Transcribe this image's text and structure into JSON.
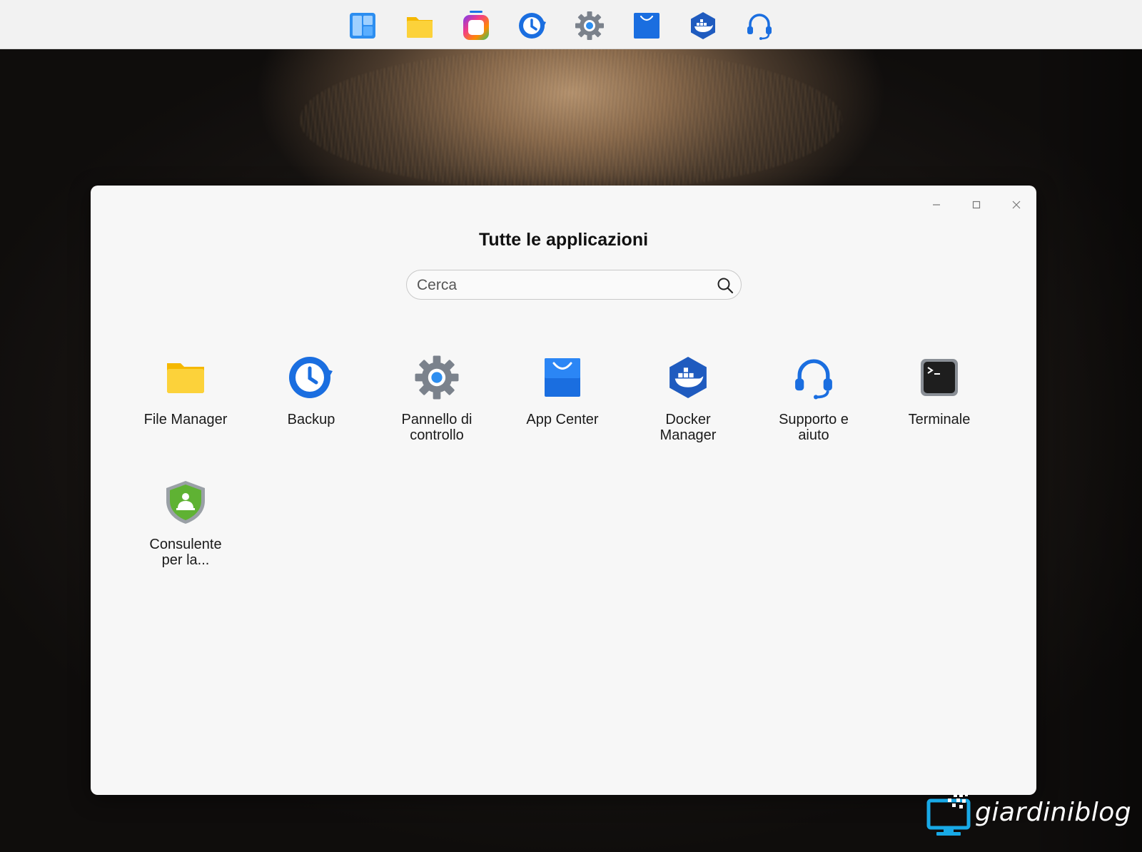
{
  "dock": {
    "items": [
      {
        "icon": "dashboard-icon"
      },
      {
        "icon": "file-manager-icon"
      },
      {
        "icon": "all-apps-icon"
      },
      {
        "icon": "backup-icon"
      },
      {
        "icon": "control-panel-icon"
      },
      {
        "icon": "app-center-icon"
      },
      {
        "icon": "docker-manager-icon"
      },
      {
        "icon": "support-icon"
      }
    ]
  },
  "window": {
    "title": "Tutte le applicazioni",
    "search": {
      "placeholder": "Cerca",
      "value": ""
    },
    "controls": {
      "minimize": "minimize-icon",
      "maximize": "maximize-icon",
      "close": "close-icon"
    },
    "apps": [
      {
        "label": "File Manager",
        "icon": "file-manager-icon"
      },
      {
        "label": "Backup",
        "icon": "backup-icon"
      },
      {
        "label": "Pannello di controllo",
        "icon": "control-panel-icon"
      },
      {
        "label": "App Center",
        "icon": "app-center-icon"
      },
      {
        "label": "Docker Manager",
        "icon": "docker-manager-icon"
      },
      {
        "label": "Supporto e aiuto",
        "icon": "support-icon"
      },
      {
        "label": "Terminale",
        "icon": "terminal-icon"
      },
      {
        "label": "Consulente per la...",
        "icon": "security-advisor-icon"
      }
    ]
  },
  "watermark": {
    "text": "giardiniblog"
  },
  "colors": {
    "accent_blue": "#1a73e8",
    "folder_yellow": "#f7c613",
    "gear_gray": "#7b828c",
    "shield_green": "#5fb233",
    "window_bg": "#f7f7f7",
    "dock_bg": "#f2f2f2"
  }
}
